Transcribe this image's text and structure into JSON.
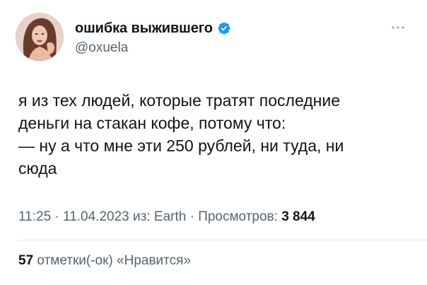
{
  "author": {
    "display_name": "ошибка выжившего",
    "handle": "@oxuela",
    "verified": true,
    "verified_color": "#1d9bf0"
  },
  "tweet": {
    "lines": [
      "я из тех людей, которые тратят последние",
      "деньги на стакан кофе, потому что:",
      "— ну а что мне эти 250 рублей, ни туда, ни",
      "сюда"
    ]
  },
  "meta": {
    "time": "11:25",
    "separator": "·",
    "date": "11.04.2023",
    "source_prefix": "из:",
    "source": "Earth",
    "views_label": "Просмотров:",
    "views_count": "3 844"
  },
  "engagement": {
    "likes_count": "57",
    "likes_label": "отметки(-ок) «Нравится»"
  },
  "icons": {
    "verified": "verified-badge-icon",
    "more": "more-dots-icon"
  }
}
